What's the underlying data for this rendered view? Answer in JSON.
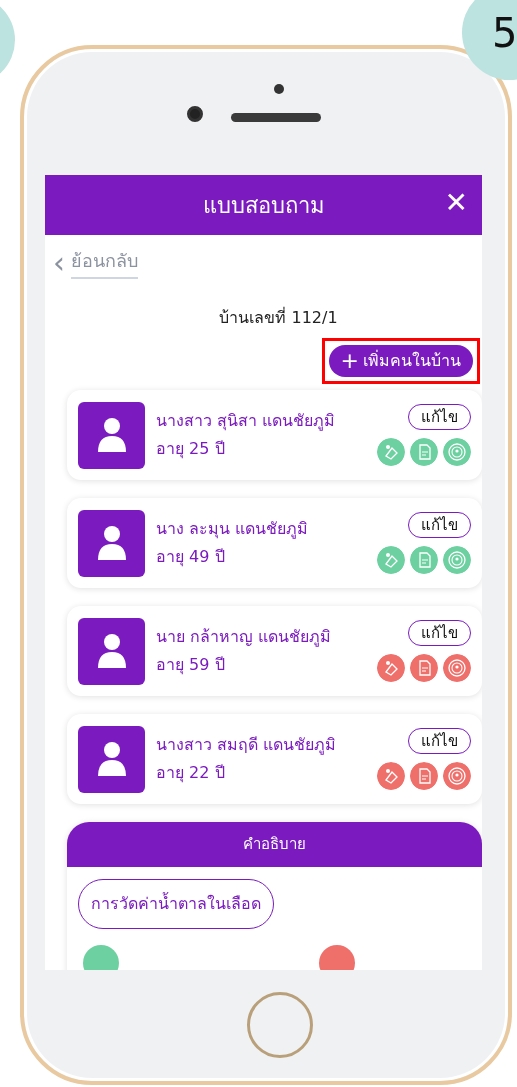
{
  "step_number": "5",
  "header": {
    "title": "แบบสอบถาม",
    "close_icon": "✕"
  },
  "back": {
    "chevron": "‹",
    "label": "ย้อนกลับ"
  },
  "house_label": "บ้านเลขที่ 112/1",
  "add_button": {
    "icon": "+",
    "label": "เพิ่มคนในบ้าน",
    "highlighted": true
  },
  "members": [
    {
      "name": "นางสาว สุนิสา แดนชัยภูมิ",
      "age": "อายุ 25 ปี",
      "edit": "แก้ไข",
      "color": "#6dd0a0"
    },
    {
      "name": "นาง ละมุน แดนชัยภูมิ",
      "age": "อายุ 49 ปี",
      "edit": "แก้ไข",
      "color": "#6dd0a0"
    },
    {
      "name": "นาย กล้าหาญ แดนชัยภูมิ",
      "age": "อายุ 59 ปี",
      "edit": "แก้ไข",
      "color": "#ef6f6a"
    },
    {
      "name": "นางสาว สมฤดี แดนชัยภูมิ",
      "age": "อายุ 22 ปี",
      "edit": "แก้ไข",
      "color": "#ef6f6a"
    }
  ],
  "legend": {
    "title": "คำอธิบาย",
    "chip": "การวัดค่าน้ำตาลในเลือด",
    "dots": [
      {
        "color": "#6dd0a0"
      },
      {
        "color": "#ef6f6a"
      }
    ]
  }
}
